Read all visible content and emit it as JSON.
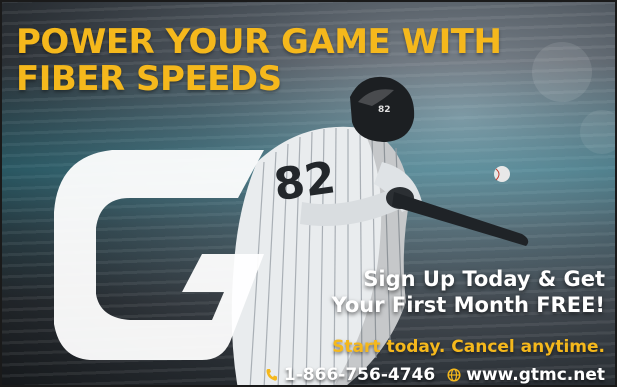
{
  "headline": {
    "line1": "POWER YOUR GAME WITH",
    "line2": "FIBER SPEEDS"
  },
  "offer": {
    "line1": "Sign Up Today & Get",
    "line2": "Your First Month FREE!"
  },
  "tagline": "Start today. Cancel anytime.",
  "contact": {
    "phone": "1-866-756-4746",
    "website": "www.gtmc.net"
  },
  "player": {
    "jersey_number": "82"
  },
  "icons": [
    "phone-icon",
    "globe-icon"
  ],
  "colors": {
    "accent_yellow": "#f5b81c",
    "text_white": "#ffffff",
    "background_dark": "#272c31"
  }
}
